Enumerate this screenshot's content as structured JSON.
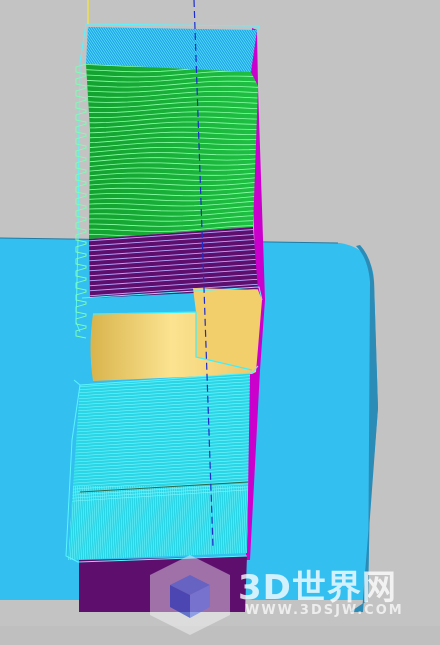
{
  "colors": {
    "background": "#c3c3c3",
    "fixture_top": "#33bff0",
    "fixture_side": "#2f97c4",
    "part_magenta": "#cc00cc",
    "part_purple": "#5e0f6e",
    "part_blue": "#23a5e6",
    "part_green": "#19b33a",
    "part_yellow": "#f6da80",
    "part_cyan": "#2ad6e6",
    "toolpath_cyan": "#53f3ff",
    "toolpath_green": "#7dffb4",
    "tool_axis": "#1d2ccc"
  },
  "viewport": {
    "watermark": {
      "text": "3D世界网",
      "url": "WWW.3DSJW.COM",
      "icon": "cube-logo-icon"
    }
  }
}
